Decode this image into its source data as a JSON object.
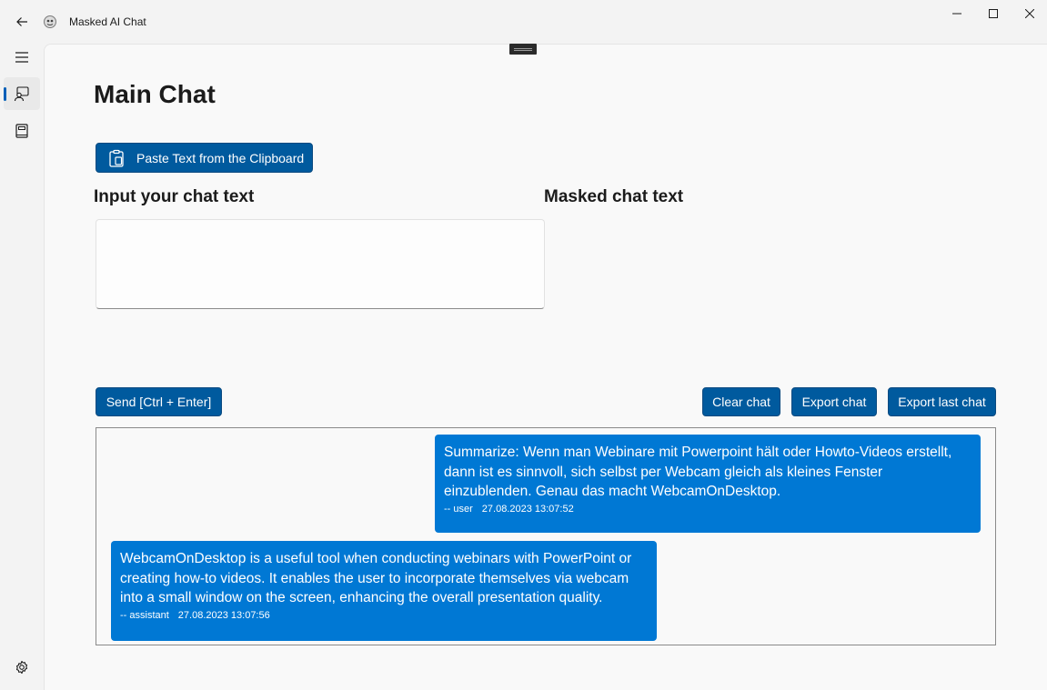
{
  "window": {
    "title": "Masked AI Chat"
  },
  "nav": {
    "items": [
      {
        "icon": "hamburger-menu-icon"
      },
      {
        "icon": "chat-person-icon",
        "selected": true
      },
      {
        "icon": "book-icon"
      },
      {
        "icon": "gear-icon"
      }
    ]
  },
  "main": {
    "title": "Main Chat",
    "paste_button": "Paste Text from the Clipboard",
    "input_label": "Input your chat text",
    "masked_label": "Masked chat text",
    "input_value": "",
    "send_button": "Send [Ctrl + Enter]",
    "clear_button": "Clear chat",
    "export_button": "Export chat",
    "export_last_button": "Export last chat"
  },
  "chat": {
    "messages": [
      {
        "role": "user",
        "text": "Summarize: Wenn man Webinare mit Powerpoint hält oder Howto-Videos erstellt, dann ist es sinnvoll, sich selbst per Webcam gleich als kleines Fenster einzublenden. Genau das macht WebcamOnDesktop.",
        "author": "-- user",
        "timestamp": "27.08.2023 13:07:52"
      },
      {
        "role": "assistant",
        "text": "WebcamOnDesktop is a useful tool when conducting webinars with PowerPoint or creating how-to videos. It enables the user to incorporate themselves via webcam into a small window on the screen, enhancing the overall presentation quality.",
        "author": "-- assistant",
        "timestamp": "27.08.2023 13:07:56"
      }
    ]
  },
  "colors": {
    "accent": "#005a9e",
    "bubble": "#0078d4"
  }
}
